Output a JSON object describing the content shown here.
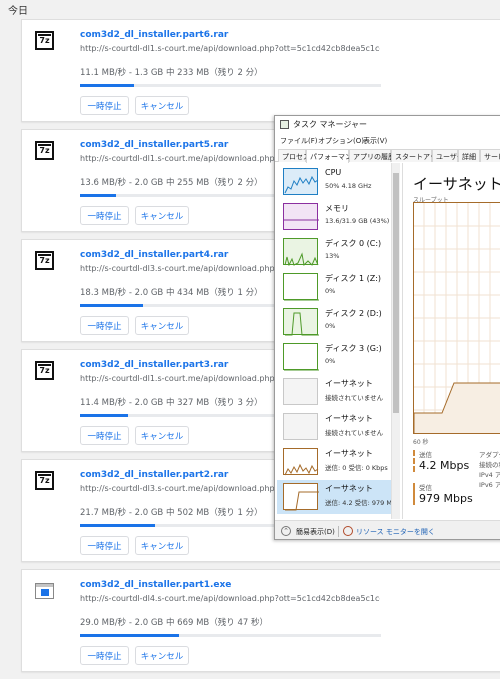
{
  "section_title": "今日",
  "downloads": [
    {
      "icon": "7z-archive-icon",
      "name": "com3d2_dl_installer.part6.rar",
      "url": "http://s-courtdl-dl1.s-court.me/api/download.php?ott=5c1cd42cb8dea5c1cd42cb8e2d&i...",
      "status": "11.1 MB/秒 - 1.3 GB 中 233 MB（残り 2 分）",
      "progress": 0.18,
      "pause_label": "一時停止",
      "cancel_label": "キャンセル"
    },
    {
      "icon": "7z-archive-icon",
      "name": "com3d2_dl_installer.part5.rar",
      "url": "http://s-courtdl-dl1.s-court.me/api/download.php?ott=5c1c",
      "status": "13.6 MB/秒 - 2.0 GB 中 255 MB（残り 2 分）",
      "progress": 0.12,
      "pause_label": "一時停止",
      "cancel_label": "キャンセル"
    },
    {
      "icon": "7z-archive-icon",
      "name": "com3d2_dl_installer.part4.rar",
      "url": "http://s-courtdl-dl3.s-court.me/api/download.php?ott=5c1c",
      "status": "18.3 MB/秒 - 2.0 GB 中 434 MB（残り 1 分）",
      "progress": 0.21,
      "pause_label": "一時停止",
      "cancel_label": "キャンセル"
    },
    {
      "icon": "7z-archive-icon",
      "name": "com3d2_dl_installer.part3.rar",
      "url": "http://s-courtdl-dl1.s-court.me/api/download.php?ott=5c1c",
      "status": "11.4 MB/秒 - 2.0 GB 中 327 MB（残り 3 分）",
      "progress": 0.16,
      "pause_label": "一時停止",
      "cancel_label": "キャンセル"
    },
    {
      "icon": "7z-archive-icon",
      "name": "com3d2_dl_installer.part2.rar",
      "url": "http://s-courtdl-dl3.s-court.me/api/download.php?ott=5c1c",
      "status": "21.7 MB/秒 - 2.0 GB 中 502 MB（残り 1 分）",
      "progress": 0.25,
      "pause_label": "一時停止",
      "cancel_label": "キャンセル"
    },
    {
      "icon": "exe-file-icon",
      "name": "com3d2_dl_installer.part1.exe",
      "url": "http://s-courtdl-dl4.s-court.me/api/download.php?ott=5c1cd42cb8dea5c1cd42cb8e2d&i...",
      "status": "29.0 MB/秒 - 2.0 GB 中 669 MB（残り 47 秒）",
      "progress": 0.33,
      "pause_label": "一時停止",
      "cancel_label": "キャンセル"
    }
  ],
  "task_manager": {
    "title": "タスク マネージャー",
    "menu": [
      "ファイル(F)",
      "オプション(O)",
      "表示(V)"
    ],
    "tabs": [
      "プロセス",
      "パフォーマンス",
      "アプリの履歴",
      "スタートアップ",
      "ユーザー",
      "詳細",
      "サービ"
    ],
    "active_tab": 1,
    "resources": [
      {
        "name": "CPU",
        "sub": "50%  4.18 GHz",
        "color": "#1f7fc4",
        "fill": "#dcecf8",
        "selected": false
      },
      {
        "name": "メモリ",
        "sub": "13.6/31.9 GB (43%)",
        "color": "#8b2fa0",
        "fill": "#f2e4f5",
        "selected": false
      },
      {
        "name": "ディスク 0 (C:)",
        "sub": "13%",
        "color": "#4e9a29",
        "fill": "#eaf4e3",
        "selected": false
      },
      {
        "name": "ディスク 1 (Z:)",
        "sub": "0%",
        "color": "#4e9a29",
        "fill": "#ffffff",
        "selected": false
      },
      {
        "name": "ディスク 2 (D:)",
        "sub": "0%",
        "color": "#4e9a29",
        "fill": "#eaf4e3",
        "selected": false
      },
      {
        "name": "ディスク 3 (G:)",
        "sub": "0%",
        "color": "#4e9a29",
        "fill": "#ffffff",
        "selected": false
      },
      {
        "name": "イーサネット",
        "sub": "接続されていません",
        "color": "#c8c8c8",
        "fill": "#f4f4f4",
        "selected": false
      },
      {
        "name": "イーサネット",
        "sub": "接続されていません",
        "color": "#c8c8c8",
        "fill": "#f4f4f4",
        "selected": false
      },
      {
        "name": "イーサネット",
        "sub": "送信: 0  受信: 0 Kbps",
        "color": "#a56b2a",
        "fill": "#ffffff",
        "selected": false
      },
      {
        "name": "イーサネット",
        "sub": "送信: 4.2  受信: 979 M",
        "color": "#a56b2a",
        "fill": "#ffffff",
        "selected": true
      }
    ],
    "detail_title": "イーサネット",
    "throughput_label": "スループット",
    "axis_label": "60 秒",
    "send_label": "送信",
    "send_value": "4.2 Mbps",
    "recv_label": "受信",
    "recv_value": "979 Mbps",
    "side_labels": [
      "アダプタ",
      "接続の種",
      "IPv4 ア",
      "IPv6 ア"
    ],
    "simple_view": "簡易表示(D)",
    "resource_monitor": "リソース モニターを開く",
    "accent": "#a56b2a"
  }
}
